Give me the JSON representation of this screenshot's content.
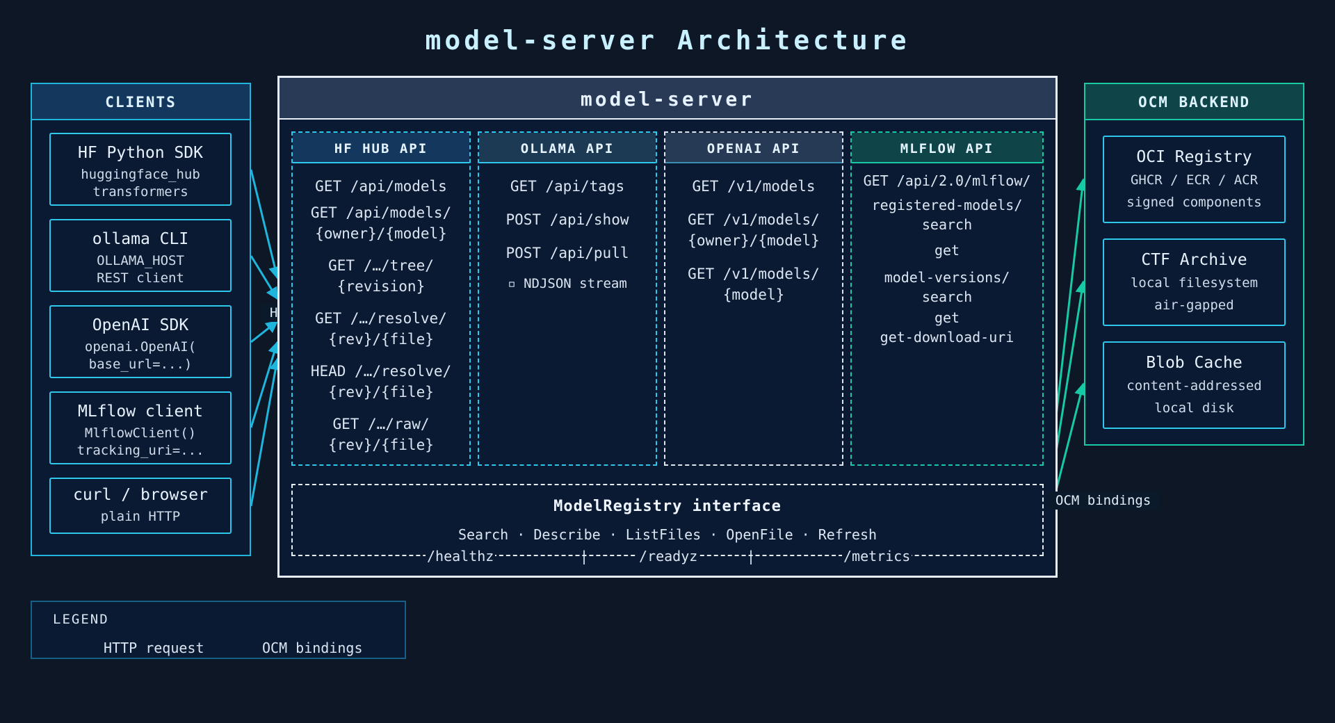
{
  "title": "model-server Architecture",
  "clients": {
    "header": "CLIENTS",
    "items": [
      {
        "title": "HF Python SDK",
        "lines": [
          "huggingface_hub",
          "transformers"
        ]
      },
      {
        "title": "ollama CLI",
        "lines": [
          "OLLAMA_HOST",
          "REST client"
        ]
      },
      {
        "title": "OpenAI SDK",
        "lines": [
          "openai.OpenAI(",
          "base_url=...)"
        ]
      },
      {
        "title": "MLflow client",
        "lines": [
          "MlflowClient()",
          "tracking_uri=..."
        ]
      },
      {
        "title": "curl / browser",
        "lines": [
          "plain HTTP"
        ]
      }
    ]
  },
  "http_label": "HTTP",
  "server": {
    "header": "model-server",
    "apis": [
      {
        "name": "HF HUB API",
        "endpoints": [
          "GET /api/models",
          "GET /api/models/\n{owner}/{model}",
          "GET /…/tree/\n{revision}",
          "GET /…/resolve/\n{rev}/{file}",
          "HEAD /…/resolve/\n{rev}/{file}",
          "GET /…/raw/\n{rev}/{file}"
        ]
      },
      {
        "name": "OLLAMA API",
        "endpoints": [
          "GET /api/tags",
          "POST /api/show",
          "POST /api/pull",
          "▫ NDJSON stream"
        ]
      },
      {
        "name": "OPENAI API",
        "endpoints": [
          "GET /v1/models",
          "GET /v1/models/\n{owner}/{model}",
          "GET /v1/models/\n{model}"
        ]
      },
      {
        "name": "MLFLOW API",
        "endpoints": [
          "GET /api/2.0/mlflow/",
          "registered-models/\nsearch",
          "get",
          "model-versions/\nsearch",
          "get\nget-download-uri"
        ]
      }
    ],
    "registry": {
      "title": "ModelRegistry interface",
      "methods": "Search · Describe · ListFiles · OpenFile · Refresh"
    },
    "health": [
      "/healthz",
      "/readyz",
      "/metrics"
    ]
  },
  "ocm": {
    "header": "OCM BACKEND",
    "items": [
      {
        "title": "OCI Registry",
        "lines": [
          "GHCR / ECR / ACR",
          "signed components"
        ]
      },
      {
        "title": "CTF Archive",
        "lines": [
          "local filesystem",
          "air-gapped"
        ]
      },
      {
        "title": "Blob Cache",
        "lines": [
          "content-addressed",
          "local disk"
        ]
      }
    ]
  },
  "ocm_label": "OCM bindings",
  "legend": {
    "title": "LEGEND",
    "http": "HTTP request",
    "ocm": "OCM bindings"
  },
  "colors": {
    "background": "#0e1726",
    "http": "#1fb5dc",
    "ocm": "#18c9a6",
    "server_border": "#e8eef6"
  }
}
